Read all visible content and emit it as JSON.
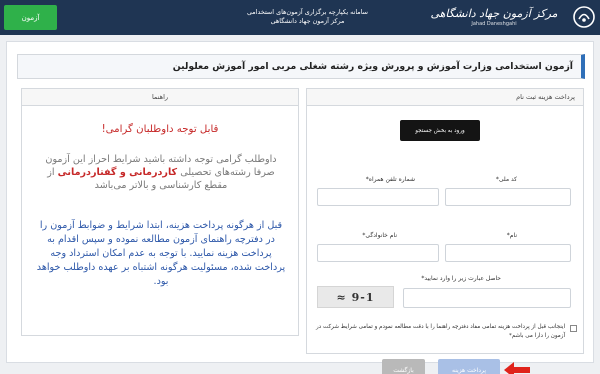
{
  "header": {
    "exam_button": "آزمون",
    "title_line1": "سامانه یکپارچه برگزاری آزمون‌های استخدامی",
    "title_line2": "مرکز آزمون جهاد دانشگاهی",
    "logo_text": "مرکز آزمون جهاد دانشگاهی",
    "logo_sub": "Jahad Daneshgahi",
    "colors": {
      "topbar": "#1f3553",
      "exam_button": "#2fb14a"
    }
  },
  "page": {
    "title": "آزمون استخدامی وزارت آموزش و پرورش ویژه رشته شغلی مربی امور آموزش معلولین"
  },
  "form": {
    "panel_title": "پرداخت هزینه ثبت نام",
    "enter_button": "ورود به بخش جستجو",
    "national_code_label": "کد ملی*",
    "mobile_label": "شماره تلفن همراه*",
    "first_name_label": "نام*",
    "last_name_label": "نام خانوادگی*",
    "captcha_label": "حاصل عبارت زیر را وارد نمایید*",
    "captcha_text": "9-1 ≈",
    "agree_text": "اینجانب قبل از پرداخت هزینه تمامی مفاد دفترچه راهنما را با دقت مطالعه نمودم و تمامی شرایط شرکت در آزمون را دارا می باشم*",
    "pay_button": "پرداخت هزینه",
    "back_button": "بازگشت",
    "colors": {
      "pay_button": "#a9c0e6",
      "back_button": "#b9b9b9",
      "arrow": "#e0231b"
    }
  },
  "guide": {
    "panel_title": "راهنما",
    "heading": "قابل توجه داوطلبان گرامی!",
    "p1_before": "داوطلب گرامی توجه داشته باشید شرایط احراز این آزمون صرفا رشته‌های تحصیلی",
    "p1_highlight1": "کاردرمانی و گفتاردرمانی",
    "p1_after": "از مقطع کارشناسی و بالاتر می‌باشد",
    "p2": "قبل از هرگونه پرداخت هزینه، ابتدا شرایط و ضوابط آزمون را در دفترچه راهنمای آزمون مطالعه نموده و سپس اقدام به پرداخت هزینه نمایید. با توجه به عدم امکان استرداد وجه پرداخت شده، مسئولیت هرگونه اشتباه بر عهده داوطلب خواهد بود.",
    "colors": {
      "heading": "#c62828",
      "p2": "#2b56a8"
    }
  }
}
